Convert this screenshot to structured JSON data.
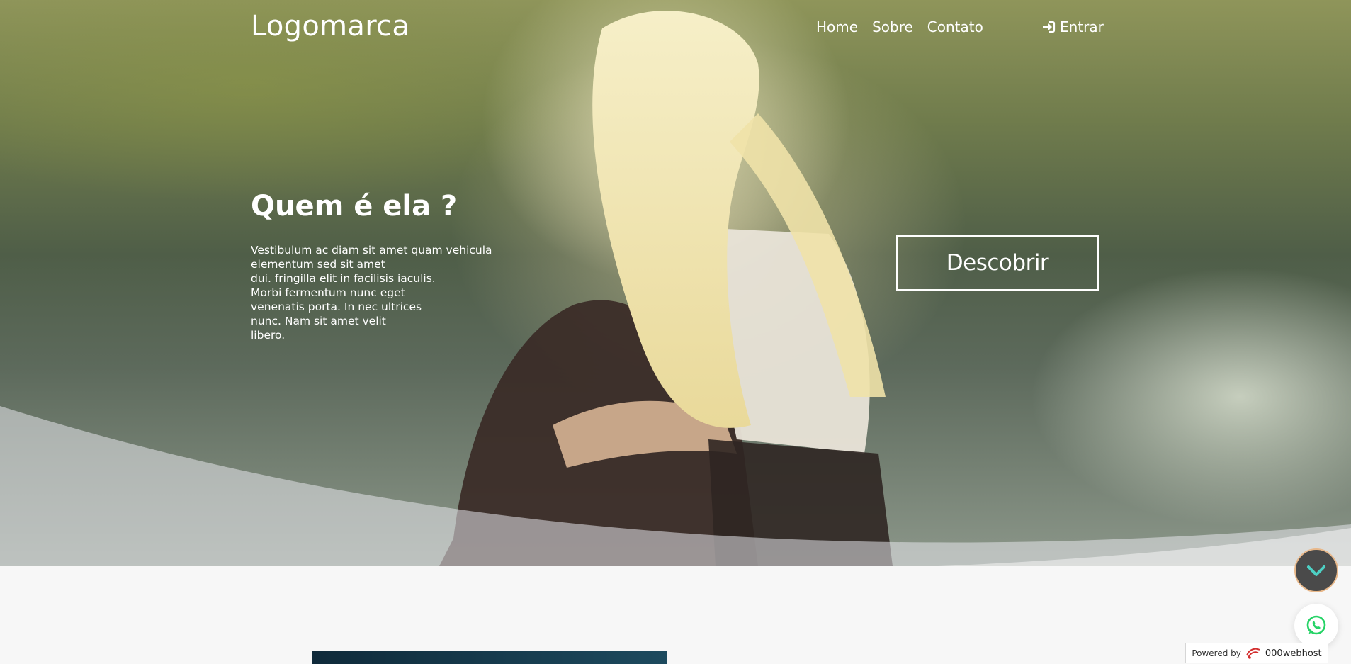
{
  "header": {
    "logo": "Logomarca",
    "nav": [
      "Home",
      "Sobre",
      "Contato"
    ],
    "login_label": "Entrar"
  },
  "hero": {
    "title": "Quem é ela ?",
    "text": "Vestibulum ac diam sit amet quam vehicula\nelementum sed sit amet\ndui. fringilla elit in facilisis iaculis.\nMorbi fermentum nunc eget\nvenenatis porta. In nec ultrices\nnunc. Nam sit amet velit\nlibero.",
    "cta_label": "Descobrir"
  },
  "floating": {
    "scroll_icon": "chevron-down-icon",
    "whatsapp_icon": "whatsapp-icon"
  },
  "footer_badge": {
    "prefix": "Powered by",
    "brand": "000webhost"
  },
  "colors": {
    "accent": "#4dd0c4",
    "whatsapp": "#25d366",
    "badge_red": "#d32f2f"
  }
}
